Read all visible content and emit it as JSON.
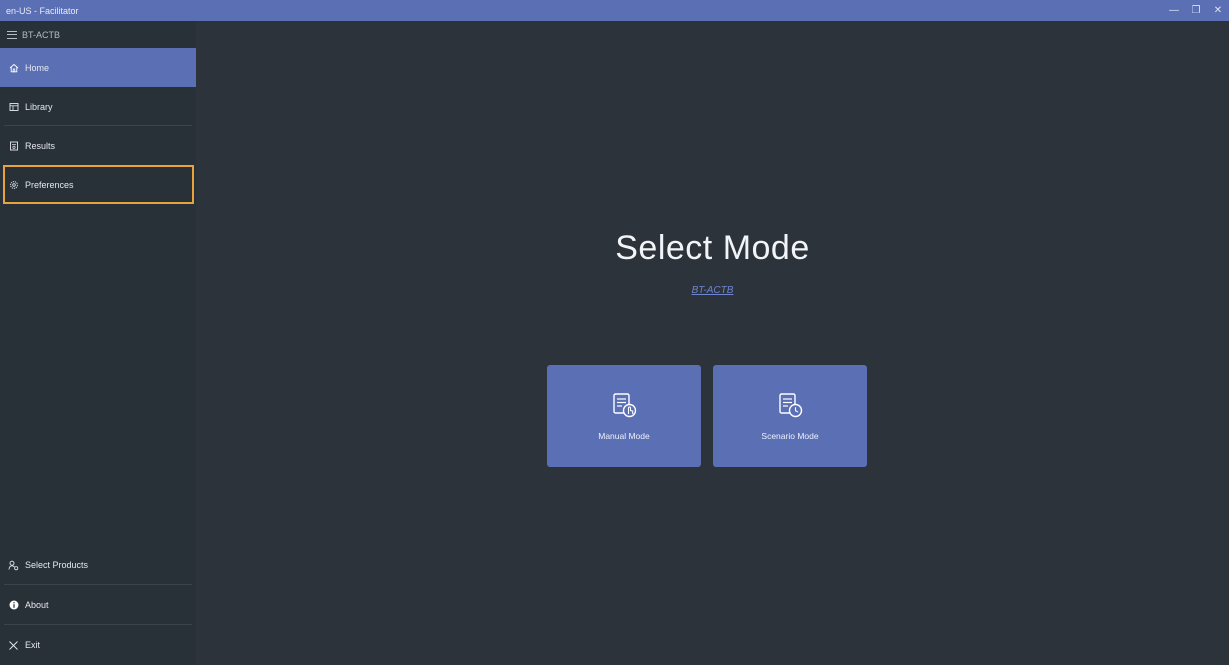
{
  "window": {
    "title": "en-US - Facilitator",
    "minimize_glyph": "—",
    "restore_glyph": "❐",
    "close_glyph": "✕"
  },
  "sidebar": {
    "header_label": "BT-ACTB",
    "items": [
      {
        "label": "Home",
        "icon": "home-icon"
      },
      {
        "label": "Library",
        "icon": "library-icon"
      },
      {
        "label": "Results",
        "icon": "results-icon"
      },
      {
        "label": "Preferences",
        "icon": "gear-icon"
      }
    ],
    "bottom_items": [
      {
        "label": "Select Products",
        "icon": "products-icon"
      },
      {
        "label": "About",
        "icon": "info-icon"
      },
      {
        "label": "Exit",
        "icon": "close-icon"
      }
    ]
  },
  "main": {
    "title": "Select Mode",
    "subtitle": "BT-ACTB",
    "modes": [
      {
        "label": "Manual Mode",
        "icon": "manual-mode-icon"
      },
      {
        "label": "Scenario Mode",
        "icon": "scenario-mode-icon"
      }
    ]
  },
  "colors": {
    "accent": "#5b6fb5",
    "focus_outline": "#e8a33c",
    "background": "#2c333b",
    "sidebar": "#283038"
  }
}
